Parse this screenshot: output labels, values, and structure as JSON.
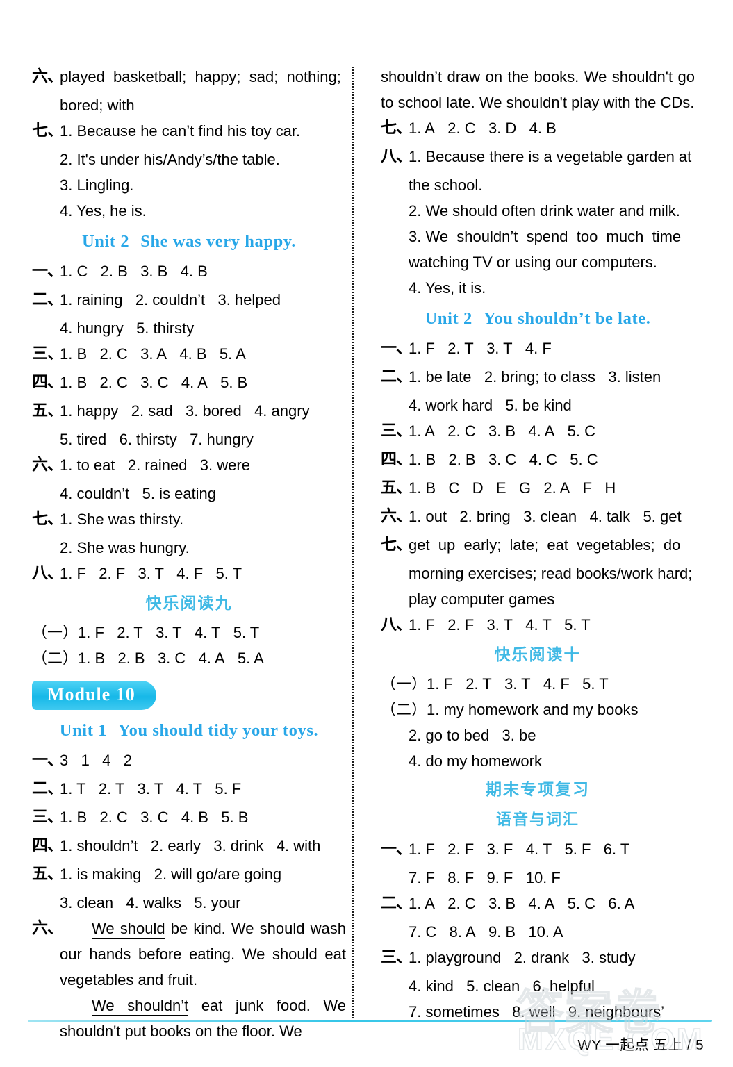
{
  "colors": {
    "heading_blue": "#28a7e8",
    "cn_heading_blue": "#3fb9e5",
    "banner_cyan": "#16b8e8",
    "rule_cyan": "#35c6e8"
  },
  "left_column": [
    {
      "kind": "row",
      "marker": "六、",
      "text": "played  basketball;  happy;  sad;  nothing;"
    },
    {
      "kind": "indent",
      "text": "bored; with"
    },
    {
      "kind": "row",
      "marker": "七、",
      "text": "1. Because he can’t find his toy car."
    },
    {
      "kind": "indent",
      "text": "2. It's under his/Andy’s/the table."
    },
    {
      "kind": "indent",
      "text": "3. Lingling."
    },
    {
      "kind": "indent",
      "text": "4. Yes, he is."
    },
    {
      "kind": "unit",
      "label": "Unit 2",
      "title": "She was very happy",
      "period": "."
    },
    {
      "kind": "row",
      "marker": "一、",
      "text": "1. C   2. B   3. B   4. B"
    },
    {
      "kind": "row",
      "marker": "二、",
      "text": "1. raining   2. couldn’t   3. helped"
    },
    {
      "kind": "indent",
      "text": "4. hungry   5. thirsty"
    },
    {
      "kind": "row",
      "marker": "三、",
      "text": "1. B   2. C   3. A   4. B   5. A"
    },
    {
      "kind": "row",
      "marker": "四、",
      "text": "1. B   2. C   3. C   4. A   5. B"
    },
    {
      "kind": "row",
      "marker": "五、",
      "text": "1. happy   2. sad   3. bored   4. angry"
    },
    {
      "kind": "indent",
      "text": "5. tired   6. thirsty   7. hungry"
    },
    {
      "kind": "row",
      "marker": "六、",
      "text": "1. to eat   2. rained   3. were"
    },
    {
      "kind": "indent",
      "text": "4. couldn’t   5. is eating"
    },
    {
      "kind": "row",
      "marker": "七、",
      "text": "1. She was thirsty."
    },
    {
      "kind": "indent",
      "text": "2. She was hungry."
    },
    {
      "kind": "row",
      "marker": "八、",
      "text": "1. F   2. F   3. T   4. F   5. T"
    },
    {
      "kind": "cn_heading",
      "text": "快乐阅读九"
    },
    {
      "kind": "plain",
      "text": "（一）1. F   2. T   3. T   4. T   5. T"
    },
    {
      "kind": "plain",
      "text": "（二）1. B   2. B   3. C   4. A   5. A"
    },
    {
      "kind": "module",
      "text": "Module 10"
    },
    {
      "kind": "unit",
      "label": "Unit 1",
      "title": "You should tidy your toys",
      "period": "."
    },
    {
      "kind": "row",
      "marker": "一、",
      "text": "3   1   4   2"
    },
    {
      "kind": "row",
      "marker": "二、",
      "text": "1. T   2. T   3. T   4. T   5. F"
    },
    {
      "kind": "row",
      "marker": "三、",
      "text": "1. B   2. C   3. C   4. B   5. B"
    },
    {
      "kind": "row",
      "marker": "四、",
      "text": "1. shouldn’t   2. early   3. drink   4. with"
    },
    {
      "kind": "row",
      "marker": "五、",
      "text": "1. is making   2. will go/are going"
    },
    {
      "kind": "indent",
      "text": "3. clean   4. walks   5. your"
    }
  ],
  "left_paragraph": {
    "marker": "六、",
    "p1_underline": "We should",
    "p1_rest": " be kind. We should wash our hands before eating. We should eat vegetables and fruit.",
    "p2_underline": "We shouldn’t",
    "p2_rest": " eat junk food. We shouldn't put books on the floor. We"
  },
  "right_column": [
    {
      "kind": "plain",
      "text": "shouldn’t draw on the books. We shouldn't go to school late. We shouldn't play with the CDs.",
      "para": true
    },
    {
      "kind": "row",
      "marker": "七、",
      "text": "1. A   2. C   3. D   4. B"
    },
    {
      "kind": "row",
      "marker": "八、",
      "text": "1. Because there is a vegetable garden at"
    },
    {
      "kind": "indent",
      "text": "the school."
    },
    {
      "kind": "indent",
      "text": "2. We should often drink water and milk."
    },
    {
      "kind": "indent_para",
      "text": "3. We  shouldn’t  spend  too  much  time"
    },
    {
      "kind": "indent",
      "text": "watching TV or using our computers."
    },
    {
      "kind": "indent",
      "text": "4. Yes, it is."
    },
    {
      "kind": "unit",
      "label": "Unit 2",
      "title": "You shouldn’t be late",
      "period": "."
    },
    {
      "kind": "row",
      "marker": "一、",
      "text": "1. F   2. T   3. T   4. F"
    },
    {
      "kind": "row",
      "marker": "二、",
      "text": "1. be late   2. bring; to class   3. listen"
    },
    {
      "kind": "indent",
      "text": "4. work hard   5. be kind"
    },
    {
      "kind": "row",
      "marker": "三、",
      "text": "1. A   2. C   3. B   4. A   5. C"
    },
    {
      "kind": "row",
      "marker": "四、",
      "text": "1. B   2. B   3. C   4. C   5. C"
    },
    {
      "kind": "row",
      "marker": "五、",
      "text": "1. B   C   D   E   G   2. A   F   H"
    },
    {
      "kind": "row",
      "marker": "六、",
      "text": "1. out   2. bring   3. clean   4. talk   5. get"
    },
    {
      "kind": "row",
      "marker": "七、",
      "text": "get  up  early;  late;  eat  vegetables;  do"
    },
    {
      "kind": "indent",
      "text": "morning exercises; read books/work hard;"
    },
    {
      "kind": "indent",
      "text": "play computer games"
    },
    {
      "kind": "row",
      "marker": "八、",
      "text": "1. F   2. F   3. T   4. T   5. T"
    },
    {
      "kind": "cn_heading",
      "text": "快乐阅读十"
    },
    {
      "kind": "plain",
      "text": "（一）1. F   2. T   3. T   4. F   5. T"
    },
    {
      "kind": "plain",
      "text": "（二）1. my homework and my books"
    },
    {
      "kind": "indent",
      "text": "2. go to bed   3. be"
    },
    {
      "kind": "indent",
      "text": "4. do my homework"
    },
    {
      "kind": "cn_heading",
      "text": "期末专项复习"
    },
    {
      "kind": "cn_heading_sub",
      "text": "语音与词汇"
    },
    {
      "kind": "row",
      "marker": "一、",
      "text": "1. F   2. F   3. F   4. T   5. F   6. T"
    },
    {
      "kind": "indent",
      "text": "7. F   8. F   9. F   10. F"
    },
    {
      "kind": "row",
      "marker": "二、",
      "text": "1. A   2. C   3. B   4. A   5. C   6. A"
    },
    {
      "kind": "indent",
      "text": "7. C   8. A   9. B   10. A"
    },
    {
      "kind": "row",
      "marker": "三、",
      "text": "1. playground   2. drank   3. study"
    },
    {
      "kind": "indent",
      "text": "4. kind   5. clean   6. helpful"
    },
    {
      "kind": "indent",
      "text": "7. sometimes   8. well   9. neighbours’"
    }
  ],
  "footer": {
    "text": "WY 一起点 五上 / 5"
  },
  "watermark": {
    "cn": "答案卷",
    "en": "MXQE.COM"
  }
}
